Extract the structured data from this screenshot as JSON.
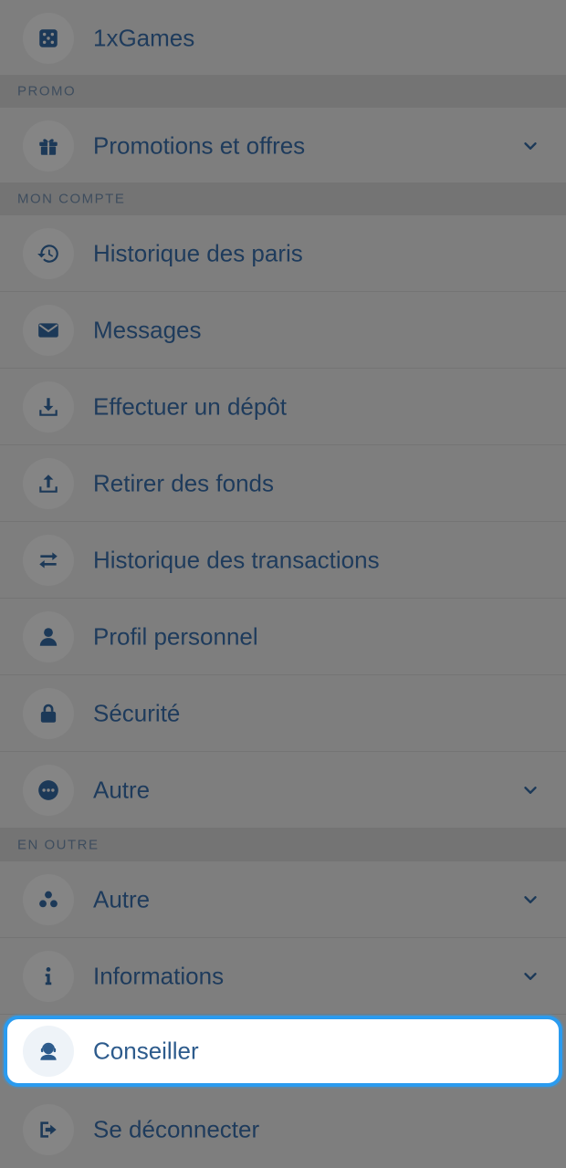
{
  "menu": {
    "games": {
      "label": "1xGames",
      "icon": "dice-icon"
    },
    "section_promo": "PROMO",
    "promotions": {
      "label": "Promotions et offres",
      "icon": "gift-icon"
    },
    "section_account": "MON COMPTE",
    "bet_history": {
      "label": "Historique des paris",
      "icon": "history-icon"
    },
    "messages": {
      "label": "Messages",
      "icon": "envelope-icon"
    },
    "deposit": {
      "label": "Effectuer un dépôt",
      "icon": "download-icon"
    },
    "withdraw": {
      "label": "Retirer des fonds",
      "icon": "upload-icon"
    },
    "transactions": {
      "label": "Historique des transactions",
      "icon": "transfer-icon"
    },
    "profile": {
      "label": "Profil personnel",
      "icon": "person-icon"
    },
    "security": {
      "label": "Sécurité",
      "icon": "lock-icon"
    },
    "other_account": {
      "label": "Autre",
      "icon": "more-dots-icon"
    },
    "section_extra": "EN OUTRE",
    "other_extra": {
      "label": "Autre",
      "icon": "three-dots-cluster-icon"
    },
    "information": {
      "label": "Informations",
      "icon": "info-icon"
    },
    "advisor": {
      "label": "Conseiller",
      "icon": "support-agent-icon"
    },
    "logout": {
      "label": "Se déconnecter",
      "icon": "logout-icon"
    }
  },
  "colors": {
    "overlay": "#7e7e7e",
    "text": "#1e3b5c",
    "highlight_border": "#2a9bef",
    "highlight_bg": "#ffffff"
  }
}
